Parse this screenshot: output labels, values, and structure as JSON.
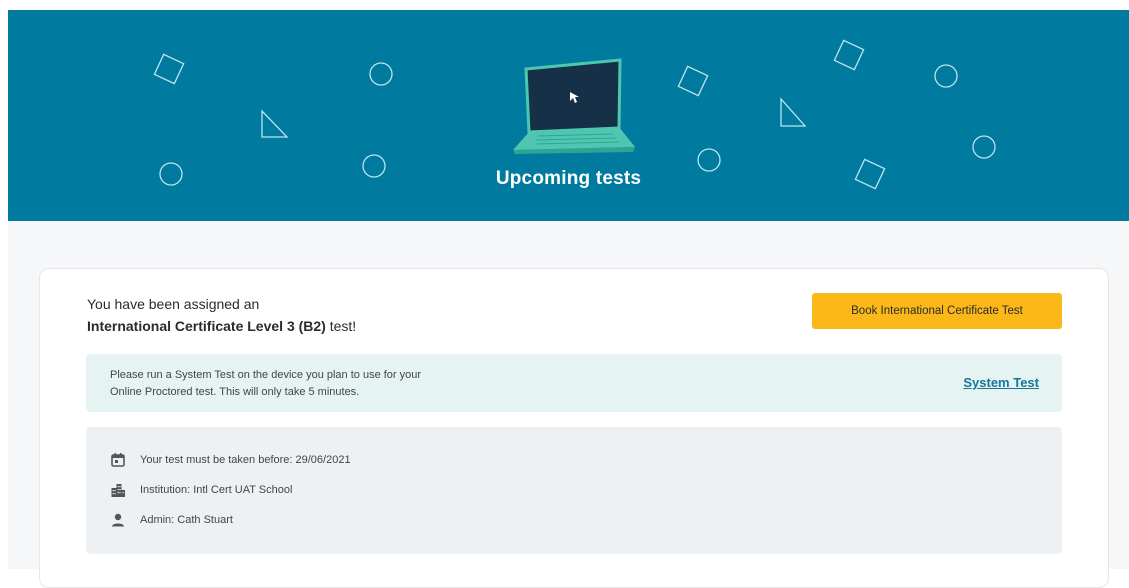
{
  "header": {
    "title": "Upcoming tests",
    "background_color": "#017a9f"
  },
  "assignment": {
    "line1": "You have been assigned an",
    "test_name": "International Certificate Level 3 (B2)",
    "suffix": "test!"
  },
  "book_button": {
    "label": "Book International Certificate Test",
    "color": "#fbb919"
  },
  "system_test": {
    "message_line1": "Please run a System Test on the device you plan to use for your",
    "message_line2": "Online Proctored test. This will only take 5 minutes.",
    "link_label": "System Test",
    "panel_color": "#e6f3f3"
  },
  "details": {
    "deadline": "Your test must be taken before: 29/06/2021",
    "institution": "Institution: Intl Cert UAT School",
    "admin": "Admin: Cath Stuart",
    "icons": [
      "calendar-icon",
      "building-icon",
      "person-icon"
    ]
  }
}
